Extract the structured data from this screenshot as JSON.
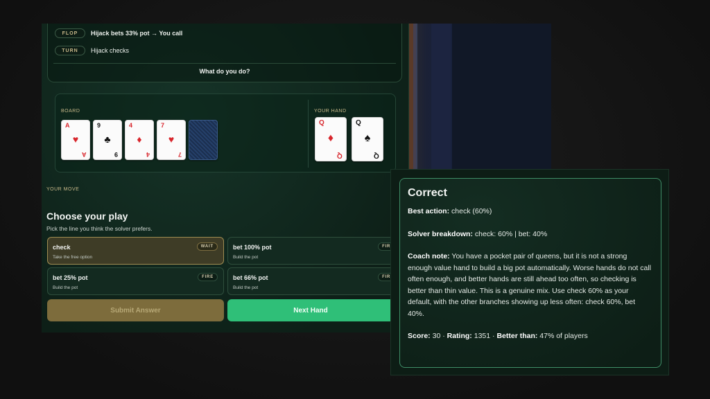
{
  "history": {
    "rows": [
      {
        "street": "FLOP",
        "text": "Hijack bets 33% pot → You call"
      },
      {
        "street": "TURN",
        "text": "Hijack checks"
      }
    ],
    "prompt": "What do you do?"
  },
  "board": {
    "label": "BOARD",
    "cards": [
      {
        "rank": "A",
        "suit": "♥",
        "color": "red"
      },
      {
        "rank": "9",
        "suit": "♣",
        "color": "black"
      },
      {
        "rank": "4",
        "suit": "♦",
        "color": "red"
      },
      {
        "rank": "7",
        "suit": "♥",
        "color": "red"
      }
    ]
  },
  "hand": {
    "label": "YOUR HAND",
    "cards": [
      {
        "rank": "Q",
        "suit": "♦",
        "color": "red"
      },
      {
        "rank": "Q",
        "suit": "♠",
        "color": "black"
      }
    ]
  },
  "move": {
    "label": "YOUR MOVE",
    "title": "Choose your play",
    "subtitle": "Pick the line you think the solver prefers.",
    "options": [
      {
        "name": "check",
        "desc": "Take the free option",
        "tag": "WAIT",
        "selected": true
      },
      {
        "name": "bet 100% pot",
        "desc": "Build the pot",
        "tag": "FIRE",
        "selected": false
      },
      {
        "name": "bet 25% pot",
        "desc": "Build the pot",
        "tag": "FIRE",
        "selected": false
      },
      {
        "name": "bet 66% pot",
        "desc": "Build the pot",
        "tag": "FIRE",
        "selected": false
      }
    ],
    "submit_label": "Submit Answer",
    "next_label": "Next Hand"
  },
  "feedback": {
    "title": "Correct",
    "best_action_label": "Best action:",
    "best_action_value": "check (60%)",
    "breakdown_label": "Solver breakdown:",
    "breakdown_value": "check: 60% | bet: 40%",
    "coach_label": "Coach note:",
    "coach_value": "You have a pocket pair of queens, but it is not a strong enough value hand to build a big pot automatically. Worse hands do not call often enough, and better hands are still ahead too often, so checking is better than thin value. This is a genuine mix. Use check 60% as your default, with the other branches showing up less often: check 60%, bet 40%.",
    "score_label": "Score:",
    "score_value": "30",
    "rating_label": "Rating:",
    "rating_value": "1351",
    "better_label": "Better than:",
    "better_value": "47% of players",
    "separator": "·"
  },
  "colors": {
    "accent_green": "#2fbf78",
    "gold": "#c9b98a",
    "card_red": "#d8262c"
  }
}
